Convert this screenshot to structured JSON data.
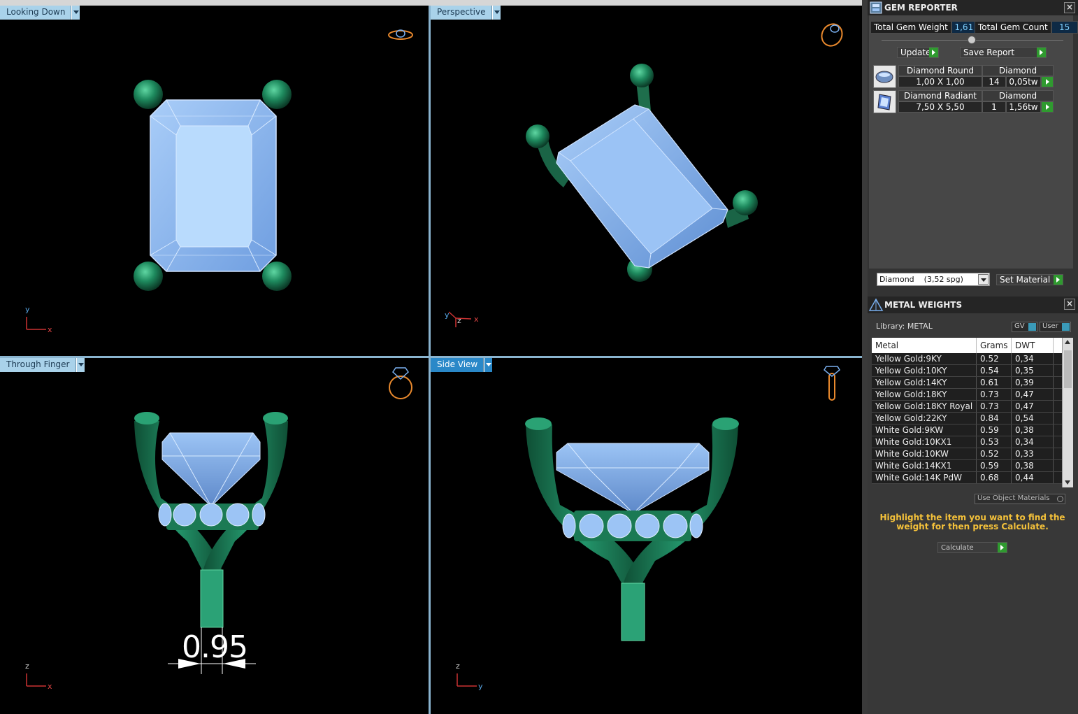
{
  "viewports": {
    "top_left": {
      "label": "Looking Down",
      "axis1": "y",
      "axis2": "x"
    },
    "top_right": {
      "label": "Perspective",
      "axis1": "y",
      "axis2": "z",
      "axis3": "x"
    },
    "bottom_left": {
      "label": "Through Finger",
      "axis1": "z",
      "axis2": "x",
      "dimension": "0.95"
    },
    "bottom_right": {
      "label": "Side View",
      "axis1": "z",
      "axis2": "y"
    }
  },
  "gem_reporter": {
    "title": "GEM REPORTER",
    "close": "×",
    "total_weight_label": "Total Gem Weight",
    "total_weight_value": "1,61",
    "total_count_label": "Total Gem Count",
    "total_count_value": "15",
    "update_label": "Update",
    "save_label": "Save Report",
    "gems": [
      {
        "name": "Diamond Round",
        "material": "Diamond",
        "size": "1,00 X 1,00",
        "count": "14",
        "weight": "0,05tw"
      },
      {
        "name": "Diamond Radiant",
        "material": "Diamond",
        "size": "7,50 X 5,50",
        "count": "1",
        "weight": "1,56tw"
      }
    ],
    "material_select": "Diamond    (3,52 spg)",
    "set_material_label": "Set Material"
  },
  "metal_weights": {
    "title": "METAL WEIGHTS",
    "close": "×",
    "library": "Library: METAL",
    "gv_label": "GV",
    "user_label": "User",
    "columns": [
      "Metal",
      "Grams",
      "DWT"
    ],
    "rows": [
      [
        "Yellow Gold:9KY",
        "0.52",
        "0,34"
      ],
      [
        "Yellow Gold:10KY",
        "0.54",
        "0,35"
      ],
      [
        "Yellow Gold:14KY",
        "0.61",
        "0,39"
      ],
      [
        "Yellow Gold:18KY",
        "0.73",
        "0,47"
      ],
      [
        "Yellow Gold:18KY Royal",
        "0.73",
        "0,47"
      ],
      [
        "Yellow Gold:22KY",
        "0.84",
        "0,54"
      ],
      [
        "White Gold:9KW",
        "0.59",
        "0,38"
      ],
      [
        "White Gold:10KX1",
        "0.53",
        "0,34"
      ],
      [
        "White Gold:10KW",
        "0.52",
        "0,33"
      ],
      [
        "White Gold:14KX1",
        "0.59",
        "0,38"
      ],
      [
        "White Gold:14K PdW",
        "0.68",
        "0,44"
      ]
    ],
    "use_object_materials": "Use Object Materials",
    "instruction": "Highlight the item you want to find the weight for then press Calculate.",
    "calculate_label": "Calculate"
  },
  "colors": {
    "viewport_tab": "#a9d2ea",
    "viewport_tab_active": "#2a88c8",
    "metal": "#1e8a5e",
    "gem": "#8fbaf0",
    "accent_green": "#2f9a2f",
    "accent_yellow": "#f4c13a"
  }
}
